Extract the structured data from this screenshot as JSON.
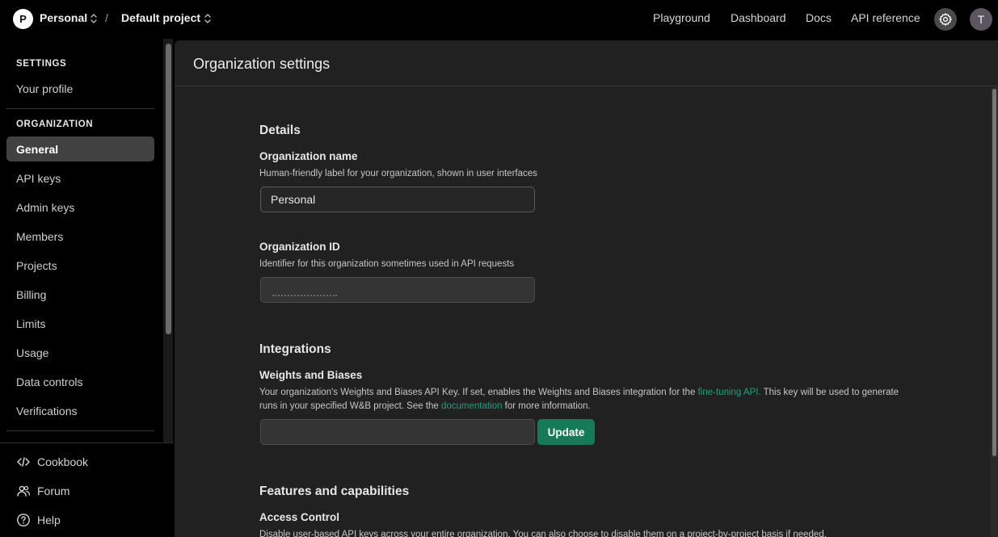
{
  "topbar": {
    "org_initial": "P",
    "org_name": "Personal",
    "separator": "/",
    "project_name": "Default project",
    "nav": {
      "playground": "Playground",
      "dashboard": "Dashboard",
      "docs": "Docs",
      "api_reference": "API reference"
    },
    "user_initial": "T"
  },
  "sidebar": {
    "settings_heading": "SETTINGS",
    "profile": "Your profile",
    "organization_heading": "ORGANIZATION",
    "items": [
      {
        "label": "General"
      },
      {
        "label": "API keys"
      },
      {
        "label": "Admin keys"
      },
      {
        "label": "Members"
      },
      {
        "label": "Projects"
      },
      {
        "label": "Billing"
      },
      {
        "label": "Limits"
      },
      {
        "label": "Usage"
      },
      {
        "label": "Data controls"
      },
      {
        "label": "Verifications"
      }
    ],
    "footer": {
      "cookbook": "Cookbook",
      "forum": "Forum",
      "help": "Help"
    }
  },
  "main": {
    "title": "Organization settings",
    "details": {
      "heading": "Details",
      "org_name_label": "Organization name",
      "org_name_help": "Human-friendly label for your organization, shown in user interfaces",
      "org_name_value": "Personal",
      "org_id_label": "Organization ID",
      "org_id_help": "Identifier for this organization sometimes used in API requests"
    },
    "integrations": {
      "heading": "Integrations",
      "wandb_label": "Weights and Biases",
      "help_part1": "Your organization's Weights and Biases API Key. If set, enables the Weights and Biases integration for the ",
      "help_link1": "fine-tuning API.",
      "help_part2": " This key will be used to generate runs in your specified W&B project. See the ",
      "help_link2": "documentation",
      "help_part3": " for more information.",
      "update_label": "Update"
    },
    "features": {
      "heading": "Features and capabilities",
      "access_label": "Access Control",
      "access_help": "Disable user-based API keys across your entire organization. You can also choose to disable them on a project-by-project basis if needed."
    }
  },
  "colors": {
    "accent_green": "#157a58",
    "link_green": "#19a37f",
    "panel_bg": "#212121"
  }
}
